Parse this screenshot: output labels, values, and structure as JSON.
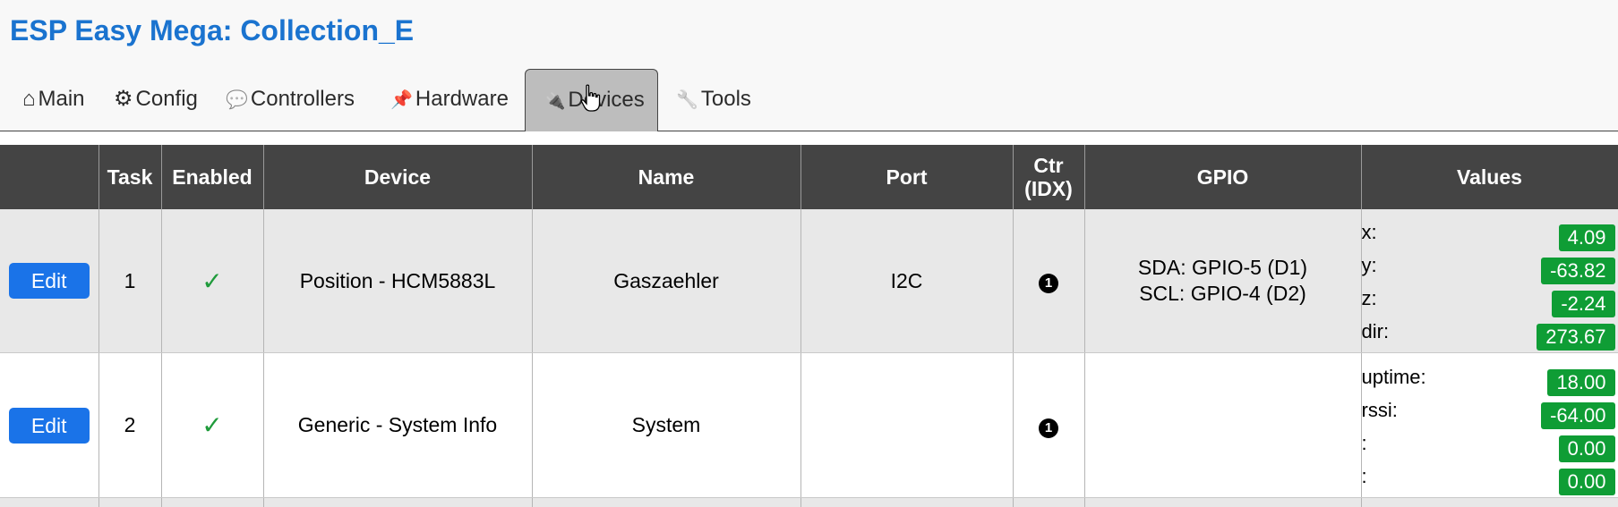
{
  "app": {
    "title": "ESP Easy Mega: Collection_E"
  },
  "tabs": [
    {
      "icon": "⌂",
      "icon_name": "home-icon",
      "label": "Main"
    },
    {
      "icon": "⚙",
      "icon_name": "gear-icon",
      "label": "Config"
    },
    {
      "icon": "💬",
      "icon_name": "speech-bubble-icon",
      "label": "Controllers"
    },
    {
      "icon": "📌",
      "icon_name": "pushpin-icon",
      "label": "Hardware"
    },
    {
      "icon": "🔌",
      "icon_name": "plug-icon",
      "label": "Devices",
      "active": true
    },
    {
      "icon": "🔧",
      "icon_name": "wrench-icon",
      "label": "Tools"
    }
  ],
  "table": {
    "headers": {
      "task": "Task",
      "enabled": "Enabled",
      "device": "Device",
      "name": "Name",
      "port": "Port",
      "ctr_line1": "Ctr",
      "ctr_line2": "(IDX)",
      "gpio": "GPIO",
      "values": "Values"
    },
    "edit_label": "Edit",
    "enabled_mark": "✓",
    "rows": [
      {
        "task": "1",
        "device": "Position - HCM5883L",
        "name": "Gaszaehler",
        "port": "I2C",
        "ctr": "1",
        "gpio_line1": "SDA: GPIO-5 (D1)",
        "gpio_line2": "SCL: GPIO-4 (D2)",
        "values": [
          {
            "label": "x:",
            "value": "4.09"
          },
          {
            "label": "y:",
            "value": "-63.82"
          },
          {
            "label": "z:",
            "value": "-2.24"
          },
          {
            "label": "dir:",
            "value": "273.67"
          }
        ]
      },
      {
        "task": "2",
        "device": "Generic - System Info",
        "name": "System",
        "port": "",
        "ctr": "1",
        "gpio_line1": "",
        "gpio_line2": "",
        "values": [
          {
            "label": "uptime:",
            "value": "18.00"
          },
          {
            "label": "rssi:",
            "value": "-64.00"
          },
          {
            "label": ":",
            "value": "0.00"
          },
          {
            "label": ":",
            "value": "0.00"
          }
        ]
      }
    ]
  },
  "colors": {
    "title": "#1a73cf",
    "header_bg": "#444444",
    "edit_button": "#1a73e8",
    "value_badge": "#0f9d35",
    "check": "#1f9b3b",
    "active_tab": "#bdbdbd"
  }
}
